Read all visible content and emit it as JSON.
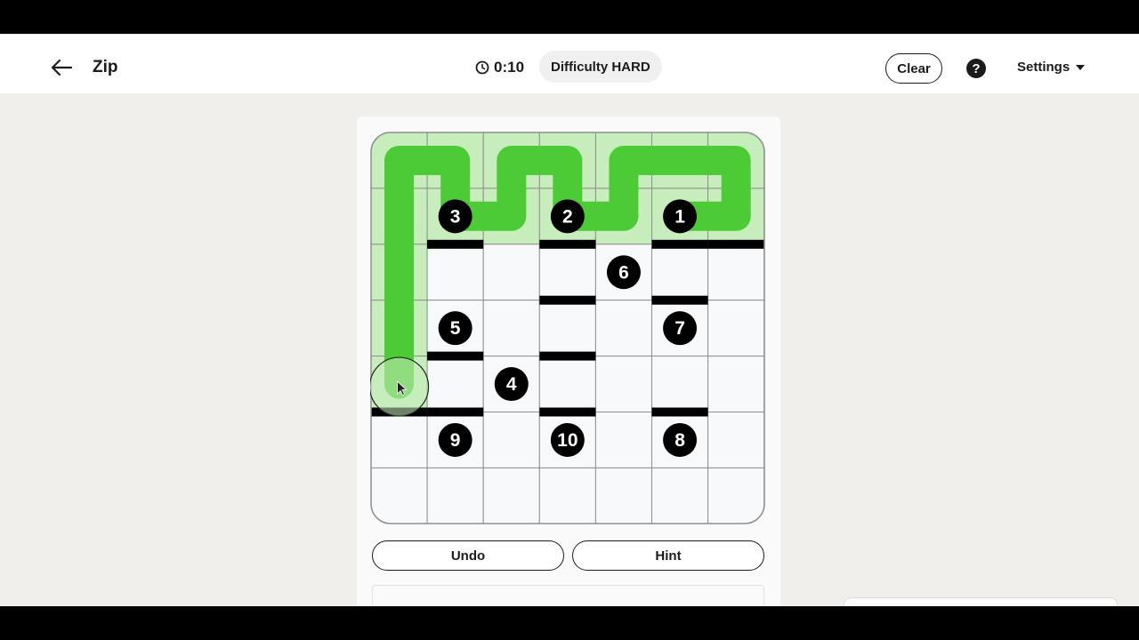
{
  "header": {
    "title": "Zip",
    "timer": "0:10",
    "difficulty": "Difficulty HARD",
    "clear_label": "Clear",
    "help_label": "?",
    "settings_label": "Settings"
  },
  "board": {
    "rows": 7,
    "cols": 7,
    "numbers": [
      {
        "label": "1",
        "row": 1,
        "col": 5
      },
      {
        "label": "2",
        "row": 1,
        "col": 3
      },
      {
        "label": "3",
        "row": 1,
        "col": 1
      },
      {
        "label": "4",
        "row": 4,
        "col": 2
      },
      {
        "label": "5",
        "row": 3,
        "col": 1
      },
      {
        "label": "6",
        "row": 2,
        "col": 4
      },
      {
        "label": "7",
        "row": 3,
        "col": 5
      },
      {
        "label": "8",
        "row": 5,
        "col": 5
      },
      {
        "label": "9",
        "row": 5,
        "col": 1
      },
      {
        "label": "10",
        "row": 5,
        "col": 3
      }
    ],
    "walls": [
      {
        "after_row": 1,
        "col": 1
      },
      {
        "after_row": 1,
        "col": 3
      },
      {
        "after_row": 1,
        "col": 5
      },
      {
        "after_row": 1,
        "col": 6
      },
      {
        "after_row": 2,
        "col": 3
      },
      {
        "after_row": 2,
        "col": 5
      },
      {
        "after_row": 3,
        "col": 1
      },
      {
        "after_row": 3,
        "col": 3
      },
      {
        "after_row": 4,
        "col": 0
      },
      {
        "after_row": 4,
        "col": 1
      },
      {
        "after_row": 4,
        "col": 3
      },
      {
        "after_row": 4,
        "col": 5
      }
    ],
    "path": [
      [
        1,
        5
      ],
      [
        1,
        6
      ],
      [
        0,
        6
      ],
      [
        0,
        5
      ],
      [
        0,
        4
      ],
      [
        1,
        4
      ],
      [
        1,
        3
      ],
      [
        0,
        3
      ],
      [
        0,
        2
      ],
      [
        1,
        2
      ],
      [
        1,
        1
      ],
      [
        0,
        1
      ],
      [
        0,
        0
      ],
      [
        1,
        0
      ],
      [
        2,
        0
      ],
      [
        3,
        0
      ],
      [
        4,
        0
      ]
    ],
    "colors": {
      "path": "#4ccb37",
      "visited": "#c8edbd",
      "cell": "#f8f9fb",
      "grid": "#8f8f8f",
      "wall": "#000000",
      "number_bg": "#000000",
      "number_text": "#ffffff"
    }
  },
  "actions": {
    "undo_label": "Undo",
    "hint_label": "Hint"
  }
}
